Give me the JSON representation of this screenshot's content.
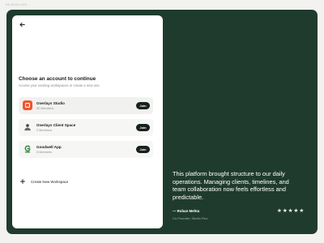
{
  "page_label": "06-0024-015",
  "card": {
    "title": "Choose an account to continue",
    "subtitle": "Access your existing workspaces or create a new one.",
    "accounts": [
      {
        "name": "Overlays Studio",
        "members": "32 Members",
        "join_label": "Join",
        "logo_color": "#f2542d",
        "icon": "overlays-logo-icon"
      },
      {
        "name": "Overlays Client Space",
        "members": "2 Members",
        "join_label": "Join",
        "logo_color": "#ffffff",
        "icon": "avatar-icon"
      },
      {
        "name": "Goodwell App",
        "members": "5 Members",
        "join_label": "Join",
        "logo_color": "#ffffff",
        "icon": "goodwell-logo-icon"
      }
    ],
    "create_label": "Create New Workspace"
  },
  "testimonial": {
    "quote": "This platform brought structure to our daily operations. Managing clients, timelines, and team collaboration now feels effortless and predictable.",
    "author": "— Rohan Mehta",
    "role": "Co-Founder, Studio Flux",
    "stars": 5
  },
  "colors": {
    "panel_green": "#1f3b2e",
    "join_button": "#16211c",
    "overlays_orange": "#f2542d",
    "goodwell_green": "#3a8a3f"
  }
}
